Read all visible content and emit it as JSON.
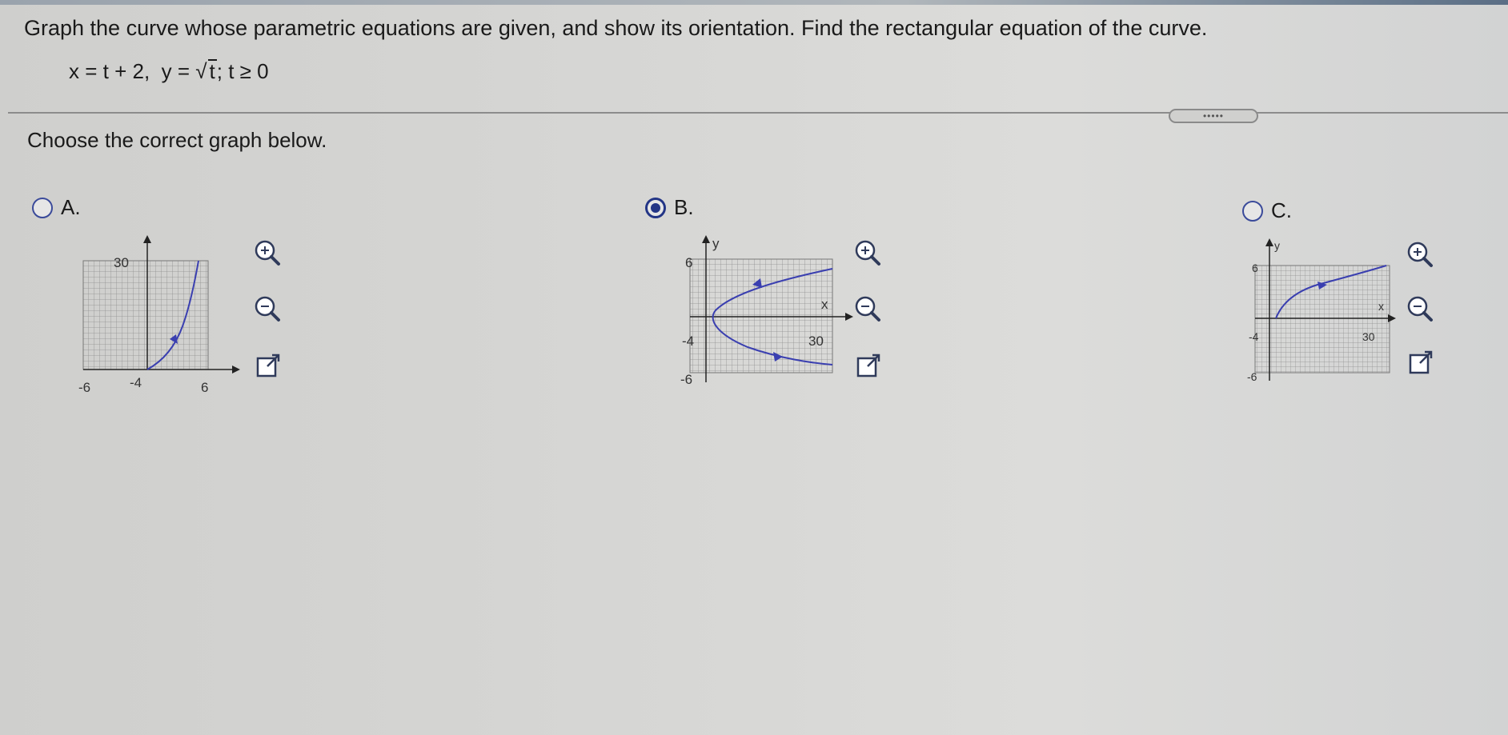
{
  "question": {
    "text": "Graph the curve whose parametric equations are given, and show its orientation. Find the rectangular equation of the curve.",
    "eq_x": "x = t + 2,",
    "eq_y_prefix": "y = ",
    "eq_radicand": "t",
    "eq_domain": ";  t ≥ 0"
  },
  "more_button": "•••••",
  "prompt": "Choose the correct graph below.",
  "options": [
    {
      "label": "A.",
      "selected": false,
      "ticks": {
        "x_min": "-6",
        "x_mid": "-4",
        "x_max": "6",
        "y_max": "30"
      },
      "tools": [
        "zoom-in-icon",
        "zoom-out-icon",
        "new-window-icon"
      ]
    },
    {
      "label": "B.",
      "selected": true,
      "ticks": {
        "y_max": "6",
        "y_min": "-6",
        "x_min": "-4",
        "x_max": "30",
        "x_axis": "x",
        "y_axis": "y"
      },
      "tools": [
        "zoom-in-icon",
        "zoom-out-icon",
        "new-window-icon"
      ]
    },
    {
      "label": "C.",
      "selected": false,
      "ticks": {
        "y_max": "6",
        "y_min": "-6",
        "x_min": "-4",
        "x_max": "30",
        "x_axis": "x",
        "y_axis": "y"
      },
      "tools": [
        "zoom-in-icon",
        "zoom-out-icon",
        "new-window-icon"
      ]
    }
  ],
  "colors": {
    "curve": "#3a3fb0",
    "accent": "#233586",
    "grid": "#8e8e8e"
  }
}
